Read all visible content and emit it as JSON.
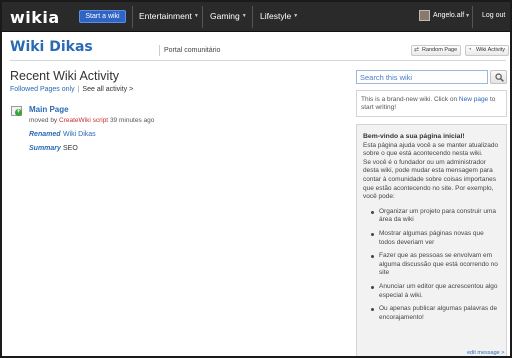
{
  "topnav": {
    "logo": "wikia",
    "start_wiki": "Start a wiki",
    "menus": [
      {
        "label": "Entertainment"
      },
      {
        "label": "Gaming"
      },
      {
        "label": "Lifestyle"
      }
    ],
    "user": "Angelo.alf",
    "logout": "Log out"
  },
  "wiki": {
    "title": "Wiki Dikas",
    "portal_link": "Portal comunitário",
    "random_page": "Random Page",
    "wiki_activity": "Wiki Activity"
  },
  "activity": {
    "title": "Recent Wiki Activity",
    "followed_pages": "Followed Pages only",
    "see_all": "See all activity >",
    "item": {
      "page_title": "Main Page",
      "moved_by": "moved by",
      "author": "CreateWiki script",
      "time": "39 minutes ago",
      "renamed_label": "Renamed",
      "renamed_value": "Wiki Dikas",
      "summary_label": "Summary",
      "summary_value": "SEO"
    }
  },
  "rail": {
    "search_placeholder": "Search this wiki",
    "notice_pre": "This is a brand-new wiki. Click on ",
    "notice_link": "New page",
    "notice_post": " to start writing!",
    "welcome_title": "Bem-vindo a sua página inicial!",
    "welcome_intro": "Esta página ajuda você a se manter atualizado sobre o que está acontecendo nesta wiki.",
    "welcome_body": "Se você é o fundador ou um administrador desta wiki, pode mudar esta mensagem para contar à comunidade sobre coisas importanes que estão acontecendo no site. Por exemplo, você pode:",
    "welcome_items": [
      "Organizar um projeto para construir uma área da wiki",
      "Mostrar algumas páginas novas que todos deveriam ver",
      "Fazer que as pessoas se envolvam em alguma discussão que está ocorrendo no site",
      "Anunciar um editor que acrescentou algo especial à wiki.",
      "Ou apenas publicar algumas palavras de encorajamento!"
    ],
    "edit_message": "edit message >"
  },
  "colors": {
    "nav_bg": "#2a2a2a",
    "accent_blue": "#2a6ab5",
    "start_button": "#2f64c4",
    "author_red": "#c7302f"
  },
  "icons": [
    "search-icon",
    "new-page-icon",
    "random-page-icon",
    "wiki-activity-icon"
  ]
}
